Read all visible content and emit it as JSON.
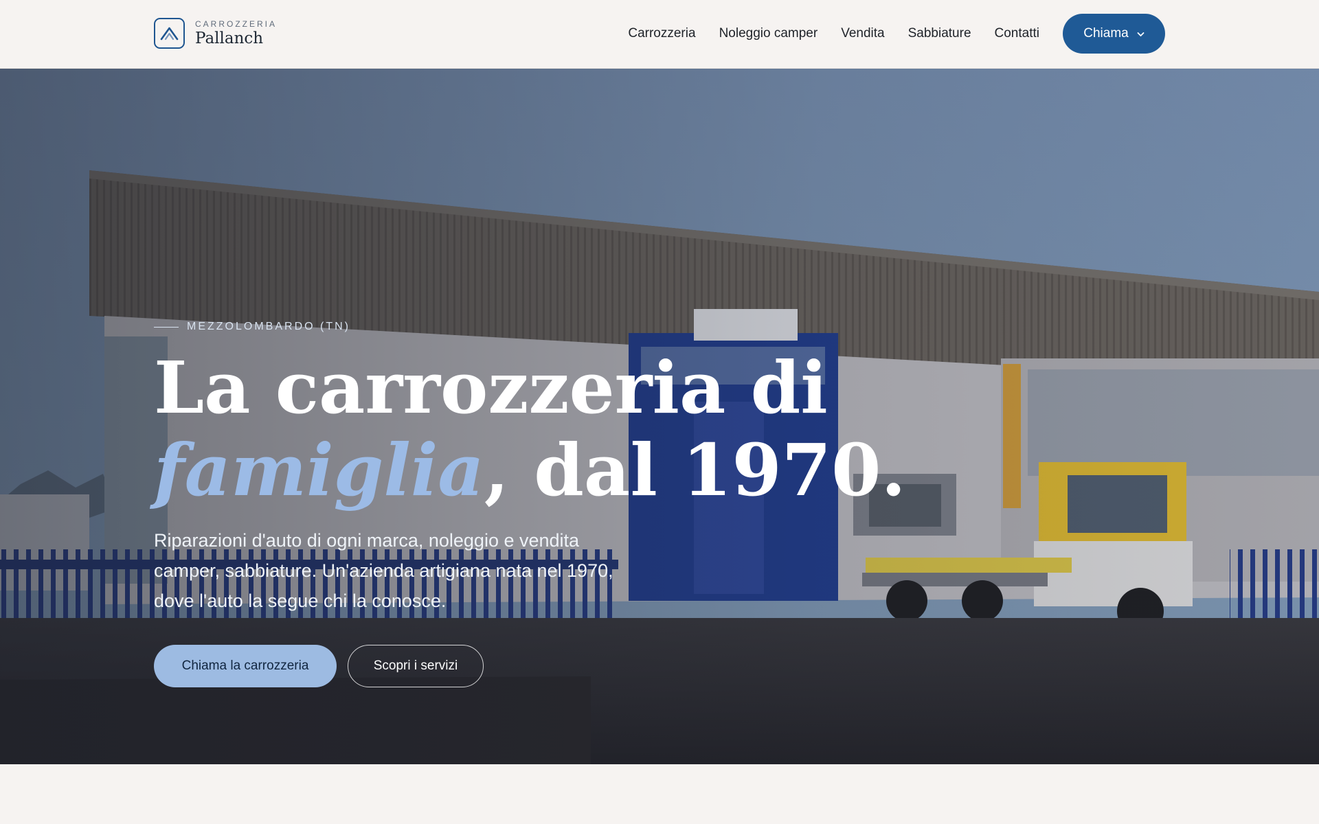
{
  "header": {
    "brand": {
      "kicker": "CARROZZERIA",
      "name": "Pallanch",
      "icon": "stylized-a-logo-icon"
    },
    "nav": [
      {
        "label": "Carrozzeria"
      },
      {
        "label": "Noleggio camper"
      },
      {
        "label": "Vendita"
      },
      {
        "label": "Sabbiature"
      },
      {
        "label": "Contatti"
      }
    ],
    "call_button": {
      "label": "Chiama",
      "icon": "chevron-down-icon",
      "color": "#1f5a96"
    }
  },
  "hero": {
    "location": "MEZZOLOMBARDO (TN)",
    "headline": {
      "part1": "La carrozzeria di",
      "accent": "famiglia",
      "part2": ", dal 1970."
    },
    "description": "Riparazioni d'auto di ogni marca, noleggio e vendita camper, sabbiature. Un'azienda artigiana nata nel 1970, dove l'auto la segue chi la conosce.",
    "primary_cta": "Chiama la carrozzeria",
    "secondary_cta": "Scopri i servizi",
    "colors": {
      "accent": "#9cbbe6",
      "primary": "#9dbbe2",
      "sky": "#7f99bc"
    }
  }
}
